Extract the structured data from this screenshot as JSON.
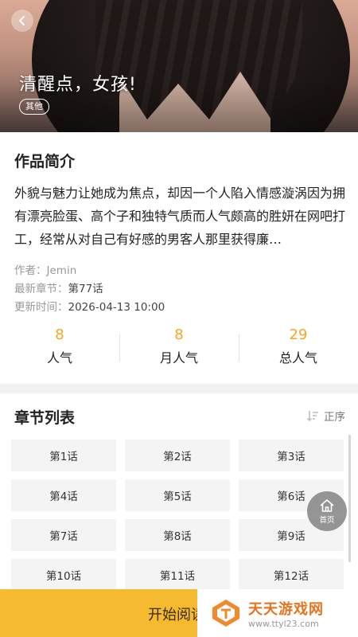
{
  "hero": {
    "title": "清醒点，女孩!",
    "tag": "其他"
  },
  "intro": {
    "section_title": "作品简介",
    "description": "外貌与魅力让她成为焦点，却因一个人陷入情感漩涡因为拥有漂亮脸蛋、高个子和独特气质而人气颇高的胜妍在网吧打工，经常从对自己有好感的男客人那里获得廉…",
    "author_label": "作者：",
    "author": "Jemin",
    "latest_label": "最新章节：",
    "latest": "第77话",
    "updated_label": "更新时间：",
    "updated": "2026-04-13 10:00"
  },
  "stats": [
    {
      "value": "8",
      "label": "人气"
    },
    {
      "value": "8",
      "label": "月人气"
    },
    {
      "value": "29",
      "label": "总人气"
    }
  ],
  "chapters": {
    "section_title": "章节列表",
    "sort_label": "正序",
    "items": [
      "第1话",
      "第2话",
      "第3话",
      "第4话",
      "第5话",
      "第6话",
      "第7话",
      "第8话",
      "第9话",
      "第10话",
      "第11话",
      "第12话"
    ]
  },
  "fab": {
    "label": "首页"
  },
  "bottom": {
    "read_label": "开始阅读"
  },
  "watermark": {
    "name": "天天游戏网",
    "url": "www.ttyl23.com"
  },
  "colors": {
    "accent": "#f5a623",
    "bottom_bar": "#f6ba30",
    "watermark": "#e8731f"
  }
}
